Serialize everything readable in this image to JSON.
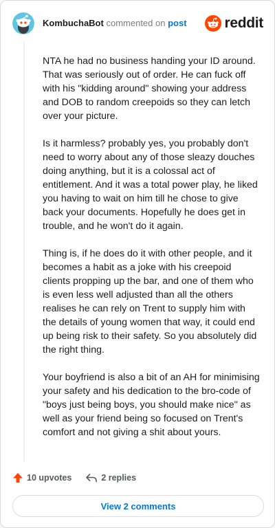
{
  "header": {
    "author": "KombuchaBot",
    "action": "commented on",
    "post_link": "post",
    "brand": "reddit"
  },
  "comment": {
    "paragraphs": [
      "NTA he had no business handing your ID around. That was seriously out of order. He can fuck off with his \"kidding around\" showing your address and DOB to random creepoids so they can letch over your picture.",
      "Is it harmless? probably yes, you probably don't need to worry about any of those sleazy douches doing anything, but it is a colossal act of entitlement. And it was a total power play, he liked you having to wait on him till he chose to give back your documents. Hopefully he does get in trouble, and he won't do it again.",
      "Thing is, if he does do it with other people, and it becomes a habit as a joke with his creepoid clients propping up the bar, and one of them who is even less well adjusted than all the others realises he can rely on Trent to supply him with the details of young women that way, it could end up being risk to their safety. So you absolutely did the right thing.",
      "Your boyfriend is also a bit of an AH for minimising your safety and his dedication to the bro-code of \"boys just being boys, you should make nice\" as well as your friend being so focused on Trent's comfort and not giving a shit about yours."
    ]
  },
  "footer": {
    "upvotes": "10 upvotes",
    "replies": "2 replies",
    "view_comments": "View 2 comments"
  },
  "colors": {
    "brand": "#ff4500",
    "link": "#0079d3",
    "avatar_bg": "#5fc5e0"
  },
  "icons": {
    "avatar": "snoo-avatar-icon",
    "logo": "reddit-logo-icon",
    "upvote": "upvote-arrow-icon",
    "reply": "reply-arrow-icon"
  }
}
